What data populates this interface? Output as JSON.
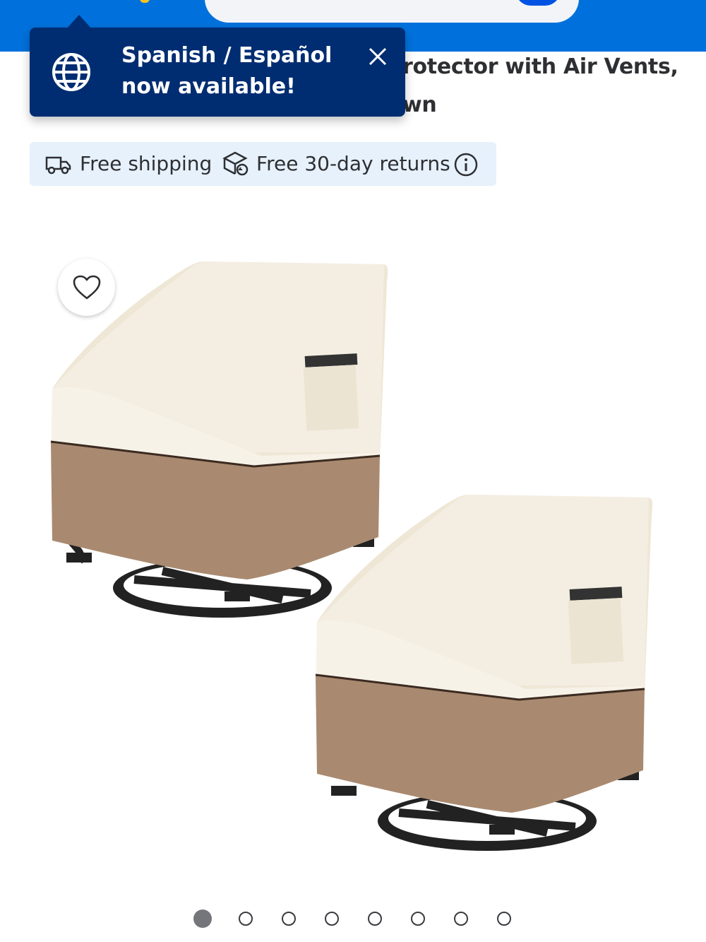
{
  "header": {
    "brand_color": "#0071dc"
  },
  "product": {
    "title_line1_visible": "rotector with Air Vents,",
    "title_line2_visible": "wn"
  },
  "tooltip": {
    "message": "Spanish / Español now available!",
    "icon": "globe-icon",
    "close_icon": "close-icon",
    "background": "#002d72"
  },
  "shipping": {
    "free_shipping_label": "Free shipping",
    "returns_label": "Free 30-day returns",
    "icons": [
      "truck-icon",
      "return-box-icon",
      "info-icon"
    ]
  },
  "gallery": {
    "favorite_icon": "heart-icon",
    "total_images": 8,
    "active_index": 0
  }
}
